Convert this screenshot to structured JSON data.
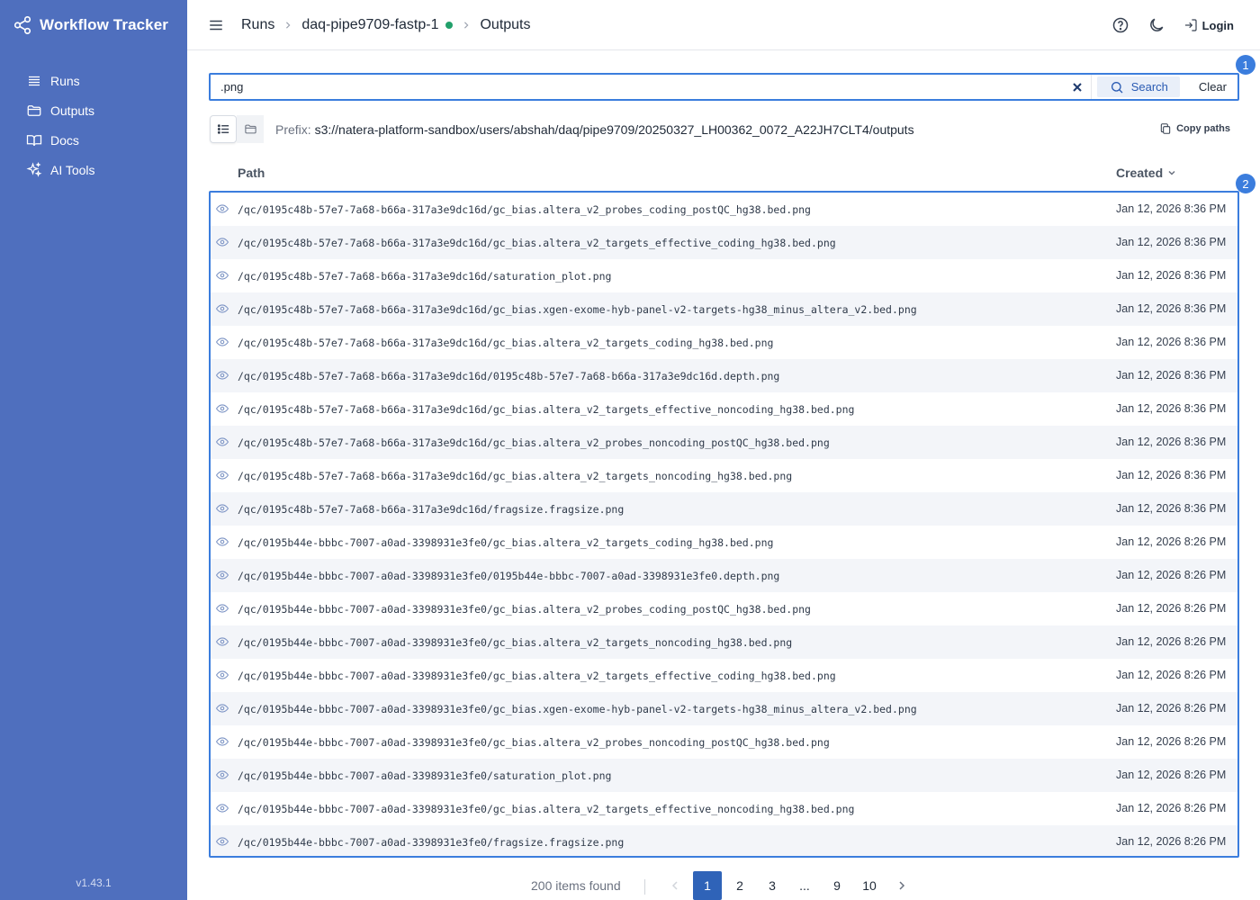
{
  "sidebar": {
    "brand": "Workflow Tracker",
    "items": [
      {
        "label": "Runs",
        "icon": "list-icon"
      },
      {
        "label": "Outputs",
        "icon": "folder-icon"
      },
      {
        "label": "Docs",
        "icon": "book-icon"
      },
      {
        "label": "AI Tools",
        "icon": "sparkles-icon"
      }
    ],
    "version": "v1.43.1"
  },
  "header": {
    "breadcrumb": [
      "Runs",
      "daq-pipe9709-fastp-1",
      "Outputs"
    ],
    "login_label": "Login"
  },
  "search": {
    "value": ".png",
    "search_label": "Search",
    "clear_label": "Clear",
    "badge": "1"
  },
  "prefix": {
    "label": "Prefix:",
    "value": "s3://natera-platform-sandbox/users/abshah/daq/pipe9709/20250327_LH00362_0072_A22JH7CLT4/outputs",
    "copy_label": "Copy paths"
  },
  "table": {
    "badge": "2",
    "headers": {
      "path": "Path",
      "created": "Created"
    },
    "rows": [
      {
        "path": "/qc/0195c48b-57e7-7a68-b66a-317a3e9dc16d/gc_bias.altera_v2_probes_coding_postQC_hg38.bed.png",
        "created": "Jan 12, 2026 8:36 PM"
      },
      {
        "path": "/qc/0195c48b-57e7-7a68-b66a-317a3e9dc16d/gc_bias.altera_v2_targets_effective_coding_hg38.bed.png",
        "created": "Jan 12, 2026 8:36 PM"
      },
      {
        "path": "/qc/0195c48b-57e7-7a68-b66a-317a3e9dc16d/saturation_plot.png",
        "created": "Jan 12, 2026 8:36 PM"
      },
      {
        "path": "/qc/0195c48b-57e7-7a68-b66a-317a3e9dc16d/gc_bias.xgen-exome-hyb-panel-v2-targets-hg38_minus_altera_v2.bed.png",
        "created": "Jan 12, 2026 8:36 PM"
      },
      {
        "path": "/qc/0195c48b-57e7-7a68-b66a-317a3e9dc16d/gc_bias.altera_v2_targets_coding_hg38.bed.png",
        "created": "Jan 12, 2026 8:36 PM"
      },
      {
        "path": "/qc/0195c48b-57e7-7a68-b66a-317a3e9dc16d/0195c48b-57e7-7a68-b66a-317a3e9dc16d.depth.png",
        "created": "Jan 12, 2026 8:36 PM"
      },
      {
        "path": "/qc/0195c48b-57e7-7a68-b66a-317a3e9dc16d/gc_bias.altera_v2_targets_effective_noncoding_hg38.bed.png",
        "created": "Jan 12, 2026 8:36 PM"
      },
      {
        "path": "/qc/0195c48b-57e7-7a68-b66a-317a3e9dc16d/gc_bias.altera_v2_probes_noncoding_postQC_hg38.bed.png",
        "created": "Jan 12, 2026 8:36 PM"
      },
      {
        "path": "/qc/0195c48b-57e7-7a68-b66a-317a3e9dc16d/gc_bias.altera_v2_targets_noncoding_hg38.bed.png",
        "created": "Jan 12, 2026 8:36 PM"
      },
      {
        "path": "/qc/0195c48b-57e7-7a68-b66a-317a3e9dc16d/fragsize.fragsize.png",
        "created": "Jan 12, 2026 8:36 PM"
      },
      {
        "path": "/qc/0195b44e-bbbc-7007-a0ad-3398931e3fe0/gc_bias.altera_v2_targets_coding_hg38.bed.png",
        "created": "Jan 12, 2026 8:26 PM"
      },
      {
        "path": "/qc/0195b44e-bbbc-7007-a0ad-3398931e3fe0/0195b44e-bbbc-7007-a0ad-3398931e3fe0.depth.png",
        "created": "Jan 12, 2026 8:26 PM"
      },
      {
        "path": "/qc/0195b44e-bbbc-7007-a0ad-3398931e3fe0/gc_bias.altera_v2_probes_coding_postQC_hg38.bed.png",
        "created": "Jan 12, 2026 8:26 PM"
      },
      {
        "path": "/qc/0195b44e-bbbc-7007-a0ad-3398931e3fe0/gc_bias.altera_v2_targets_noncoding_hg38.bed.png",
        "created": "Jan 12, 2026 8:26 PM"
      },
      {
        "path": "/qc/0195b44e-bbbc-7007-a0ad-3398931e3fe0/gc_bias.altera_v2_targets_effective_coding_hg38.bed.png",
        "created": "Jan 12, 2026 8:26 PM"
      },
      {
        "path": "/qc/0195b44e-bbbc-7007-a0ad-3398931e3fe0/gc_bias.xgen-exome-hyb-panel-v2-targets-hg38_minus_altera_v2.bed.png",
        "created": "Jan 12, 2026 8:26 PM"
      },
      {
        "path": "/qc/0195b44e-bbbc-7007-a0ad-3398931e3fe0/gc_bias.altera_v2_probes_noncoding_postQC_hg38.bed.png",
        "created": "Jan 12, 2026 8:26 PM"
      },
      {
        "path": "/qc/0195b44e-bbbc-7007-a0ad-3398931e3fe0/saturation_plot.png",
        "created": "Jan 12, 2026 8:26 PM"
      },
      {
        "path": "/qc/0195b44e-bbbc-7007-a0ad-3398931e3fe0/gc_bias.altera_v2_targets_effective_noncoding_hg38.bed.png",
        "created": "Jan 12, 2026 8:26 PM"
      },
      {
        "path": "/qc/0195b44e-bbbc-7007-a0ad-3398931e3fe0/fragsize.fragsize.png",
        "created": "Jan 12, 2026 8:26 PM"
      }
    ]
  },
  "pagination": {
    "items_found": "200 items found",
    "pages": [
      "1",
      "2",
      "3",
      "...",
      "9",
      "10"
    ],
    "current": "1"
  },
  "colors": {
    "sidebar_bg": "#4f6fbe",
    "accent": "#3b7ddd",
    "status_green": "#22a06b",
    "active_page": "#2f63b8"
  }
}
